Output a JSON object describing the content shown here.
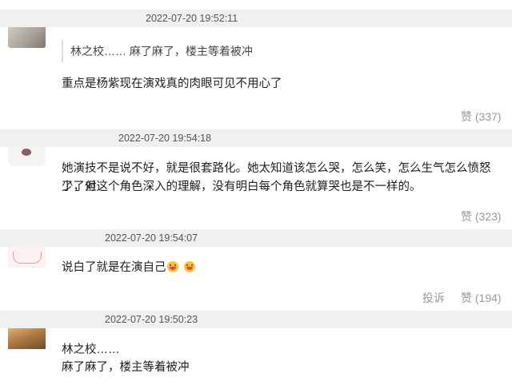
{
  "comments": [
    {
      "timestamp": "2022-07-20 19:52:11",
      "quote": "林之校…… 麻了麻了，楼主等着被冲",
      "text": "重点是杨紫现在演戏真的肉眼可见不用心了",
      "like_label": "赞 (337)"
    },
    {
      "timestamp": "2022-07-20 19:54:18",
      "text_line1": "她演技不是说不好，就是很套路化。她太知道该怎么哭，怎么笑，怎么生气怎么愤怒了，但",
      "text_line2": "少了对这个角色深入的理解，没有明白每个角色就算哭也是不一样的。",
      "like_label": "赞 (323)"
    },
    {
      "timestamp": "2022-07-20 19:54:07",
      "text": "说白了就是在演自己",
      "emojis": [
        "laughing-face-icon",
        "laughing-face-icon"
      ],
      "report_label": "投诉",
      "like_label": "赞 (194)"
    },
    {
      "timestamp": "2022-07-20 19:50:23",
      "text_line1": "林之校……",
      "text_line2": "麻了麻了，楼主等着被冲"
    }
  ]
}
